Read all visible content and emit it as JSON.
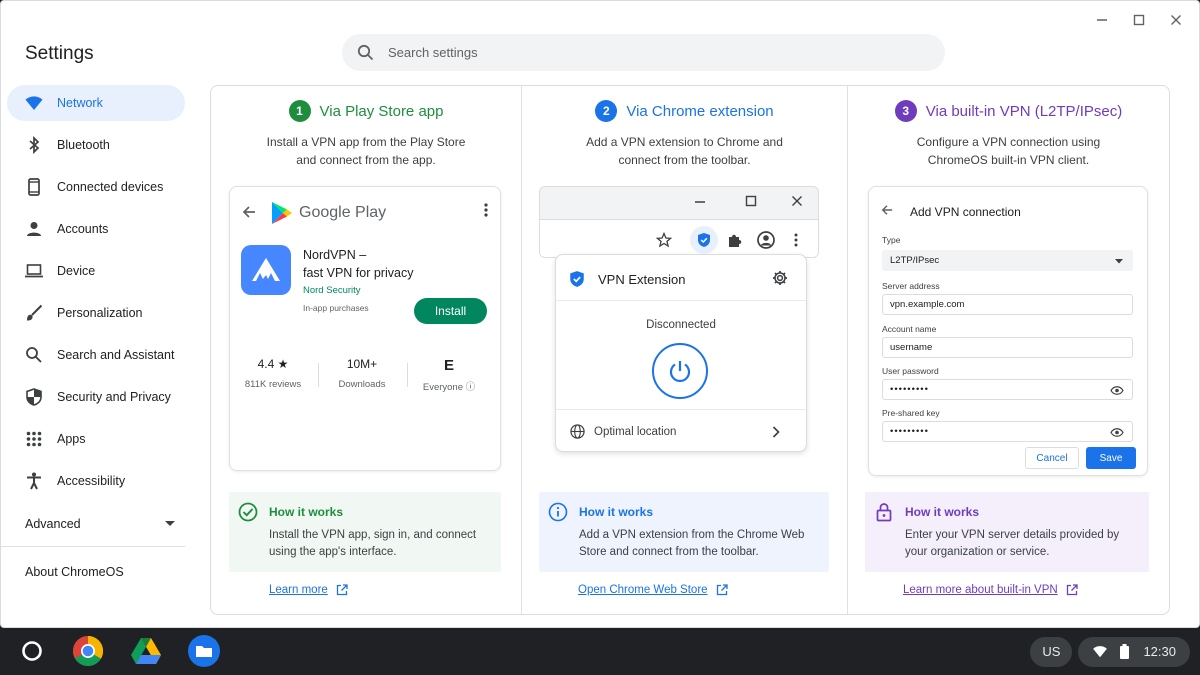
{
  "app": {
    "title": "Settings"
  },
  "search": {
    "placeholder": "Search settings"
  },
  "sidebar": {
    "items": [
      {
        "label": "Network",
        "icon": "wifi-icon",
        "active": true
      },
      {
        "label": "Bluetooth",
        "icon": "bluetooth-icon"
      },
      {
        "label": "Connected devices",
        "icon": "phone-icon"
      },
      {
        "label": "Accounts",
        "icon": "person-icon"
      },
      {
        "label": "Device",
        "icon": "laptop-icon"
      },
      {
        "label": "Personalization",
        "icon": "brush-icon"
      },
      {
        "label": "Search and Assistant",
        "icon": "search-icon"
      },
      {
        "label": "Security and Privacy",
        "icon": "shield-icon"
      },
      {
        "label": "Apps",
        "icon": "apps-grid-icon"
      },
      {
        "label": "Accessibility",
        "icon": "accessibility-icon"
      }
    ],
    "advanced": "Advanced",
    "about": "About ChromeOS"
  },
  "columns": [
    {
      "number": "1",
      "title": "Via Play Store app",
      "color": "#1e8e3e",
      "description": "Install a VPN app from the Play Store and connect from the app."
    },
    {
      "number": "2",
      "title": "Via Chrome extension",
      "color": "#1a73e8",
      "description": "Add a VPN extension to Chrome and connect from the toolbar."
    },
    {
      "number": "3",
      "title": "Via built-in VPN (L2TP/IPsec)",
      "color": "#6e3cbc",
      "description": "Configure a VPN connection using ChromeOS built-in VPN client."
    }
  ],
  "play_store": {
    "brand": "Google Play",
    "app_name": "NordVPN –\nfast VPN for privacy",
    "developer": "Nord Security",
    "iap": "In-app purchases",
    "install": "Install",
    "rating": "4.4 ★",
    "reviews": "811K reviews",
    "downloads_value": "10M+",
    "downloads_label": "Downloads",
    "content_rating": "E",
    "content_rating_label": "Everyone ⓘ"
  },
  "extension": {
    "title": "VPN Extension",
    "status": "Disconnected",
    "location": "Optimal location"
  },
  "vpn_form": {
    "title": "Add VPN connection",
    "type_label": "Type",
    "type_value": "L2TP/IPsec",
    "server_label": "Server address",
    "server_value": "vpn.example.com",
    "account_label": "Account name",
    "account_value": "username",
    "password_label": "User password",
    "password_value": "•••••••••",
    "psk_label": "Pre-shared key",
    "psk_value": "•••••••••",
    "cancel": "Cancel",
    "save": "Save"
  },
  "info_boxes": [
    {
      "heading": "How it works",
      "text": "Install the VPN app, sign in, and connect using the app's interface.",
      "link": "Learn more",
      "bg": "#f1f8f3",
      "accent": "#1e8e3e"
    },
    {
      "heading": "How it works",
      "text": "Add a VPN extension from the Chrome Web Store and connect from the toolbar.",
      "link": "Open Chrome Web Store",
      "bg": "#eef3fd",
      "accent": "#1a73e8"
    },
    {
      "heading": "How it works",
      "text": "Enter your VPN server details provided by your organization or service.",
      "link": "Learn more about built-in VPN",
      "bg": "#f4effb",
      "accent": "#6e3cbc"
    }
  ],
  "shelf": {
    "locale": "US",
    "time": "12:30"
  }
}
